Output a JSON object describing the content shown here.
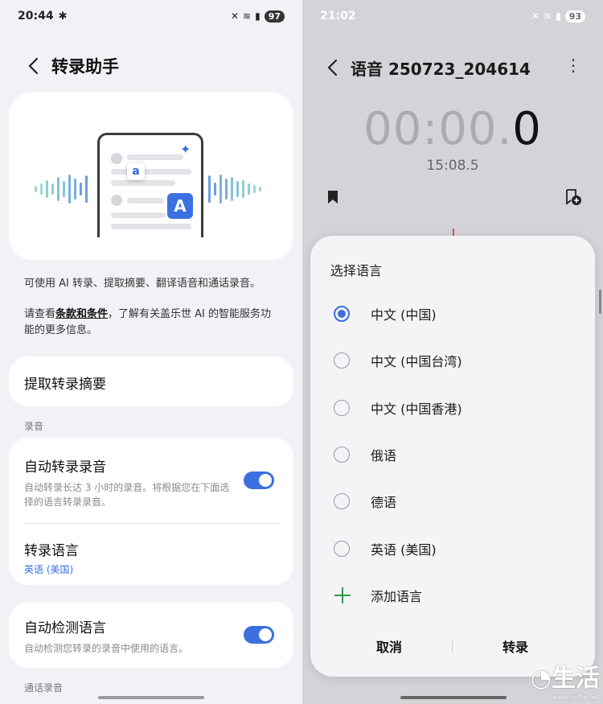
{
  "left": {
    "status": {
      "time": "20:44",
      "battery": "97"
    },
    "title": "转录助手",
    "desc1": "可使用 AI 转录、提取摘要、翻译语音和通话录音。",
    "desc2_pre": "请查看",
    "desc2_link": "条款和条件",
    "desc2_post": "，了解有关盖乐世 AI 的智能服务功能的更多信息。",
    "summary_item": "提取转录摘要",
    "section_record": "录音",
    "auto_transcribe": {
      "title": "自动转录录音",
      "sub": "自动转录长达 3 小时的录音。将根据您在下面选择的语言转录录音。"
    },
    "transcribe_language": {
      "title": "转录语言",
      "value": "英语 (美国)"
    },
    "auto_detect": {
      "title": "自动检测语言",
      "sub": "自动检测您转录的录音中使用的语言。"
    },
    "section_call": "通话录音"
  },
  "right": {
    "status": {
      "time": "21:02",
      "battery": "93"
    },
    "title": "语音 250723_204614",
    "timer_dim": "00:00.",
    "timer_bright": "0",
    "subtime": "15:08.5",
    "sheet": {
      "title": "选择语言",
      "options": [
        {
          "label": "中文 (中国)",
          "selected": true
        },
        {
          "label": "中文 (中国台湾)",
          "selected": false
        },
        {
          "label": "中文 (中国香港)",
          "selected": false
        },
        {
          "label": "俄语",
          "selected": false
        },
        {
          "label": "德语",
          "selected": false
        },
        {
          "label": "英语 (美国)",
          "selected": false
        }
      ],
      "add_language": "添加语言",
      "cancel": "取消",
      "confirm": "转录"
    }
  },
  "watermark": {
    "main": "生活",
    "sub": "www.selfje.net"
  },
  "colors": {
    "accent": "#3c6fe0",
    "add_green": "#2a9a4a"
  }
}
